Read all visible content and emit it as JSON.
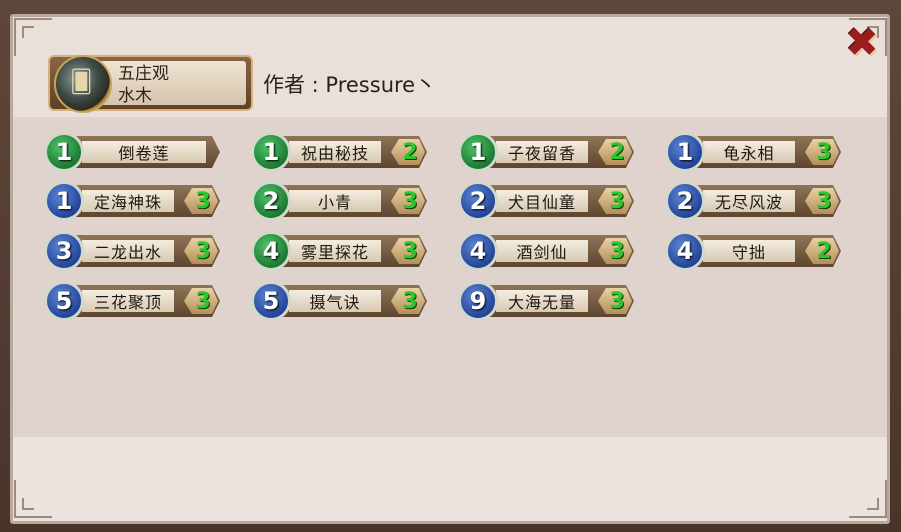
{
  "team": {
    "name": "五庄观",
    "sub": "水木",
    "author": "作者 : Pressure丶"
  },
  "close_icon": "close-x-icon",
  "colors": {
    "green_badge": "#1d7a32",
    "blue_badge": "#23459a",
    "count_text": "#2dc62d"
  },
  "heroes": [
    {
      "level": "1",
      "name": "倒卷莲",
      "count": "",
      "badge": "green"
    },
    {
      "level": "1",
      "name": "祝由秘技",
      "count": "2",
      "badge": "green"
    },
    {
      "level": "1",
      "name": "子夜留香",
      "count": "2",
      "badge": "green"
    },
    {
      "level": "1",
      "name": "龟永相",
      "count": "3",
      "badge": "blue"
    },
    {
      "level": "1",
      "name": "定海神珠",
      "count": "3",
      "badge": "blue"
    },
    {
      "level": "2",
      "name": "小青",
      "count": "3",
      "badge": "green"
    },
    {
      "level": "2",
      "name": "犬目仙童",
      "count": "3",
      "badge": "blue"
    },
    {
      "level": "2",
      "name": "无尽风波",
      "count": "3",
      "badge": "blue"
    },
    {
      "level": "3",
      "name": "二龙出水",
      "count": "3",
      "badge": "blue"
    },
    {
      "level": "4",
      "name": "雾里探花",
      "count": "3",
      "badge": "green"
    },
    {
      "level": "4",
      "name": "酒剑仙",
      "count": "3",
      "badge": "blue"
    },
    {
      "level": "4",
      "name": "守拙",
      "count": "2",
      "badge": "blue"
    },
    {
      "level": "5",
      "name": "三花聚顶",
      "count": "3",
      "badge": "blue"
    },
    {
      "level": "5",
      "name": "摄气诀",
      "count": "3",
      "badge": "blue"
    },
    {
      "level": "9",
      "name": "大海无量",
      "count": "3",
      "badge": "blue"
    }
  ]
}
